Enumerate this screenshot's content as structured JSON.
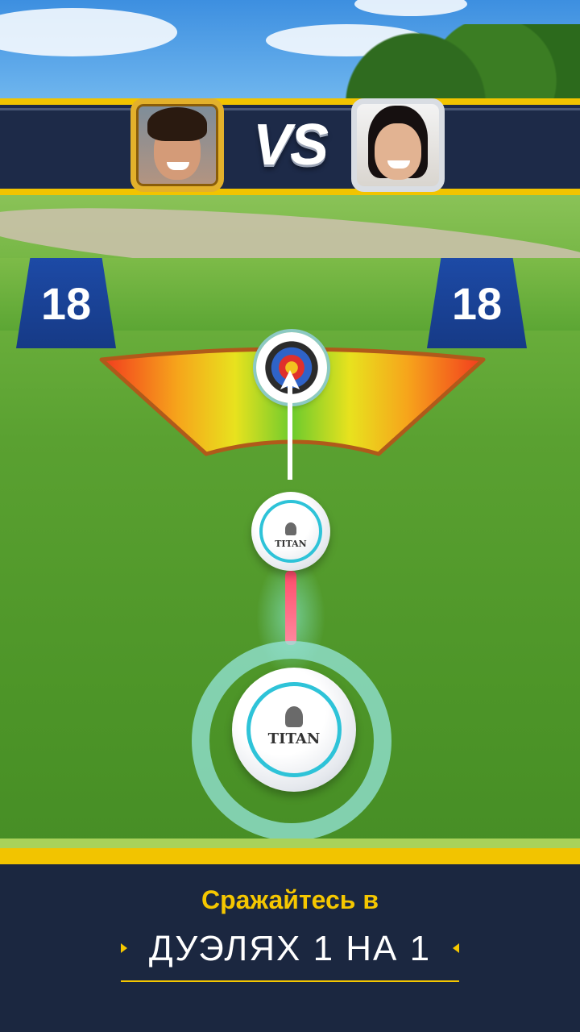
{
  "match": {
    "vs_label": "VS",
    "player_left": {
      "avatar_desc": "player-avatar-gold-frame"
    },
    "player_right": {
      "avatar_desc": "opponent-avatar-silver-frame"
    }
  },
  "markers": {
    "left_distance": "18",
    "right_distance": "18"
  },
  "ball": {
    "brand": "TITAN"
  },
  "banner": {
    "line1": "Сражайтесь в",
    "line2": "ДУЭЛЯХ 1 НА 1"
  },
  "colors": {
    "banner_bg": "#1b2740",
    "accent_yellow": "#f2c400",
    "ring_cyan": "#2ec3d8",
    "marker_blue": "#1d4aa6"
  }
}
